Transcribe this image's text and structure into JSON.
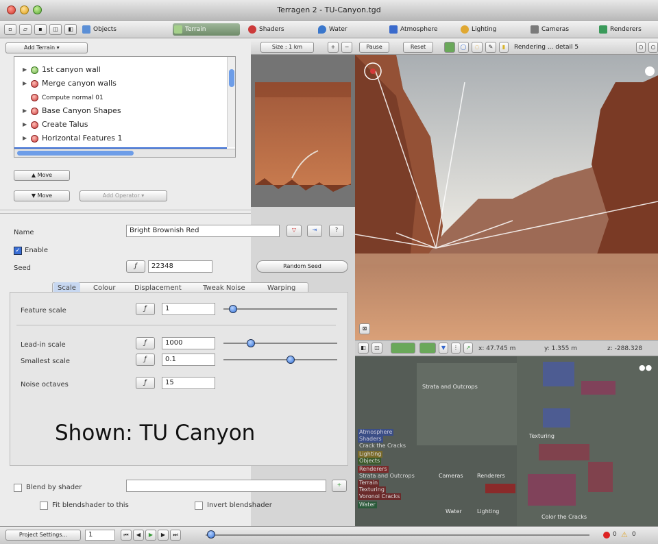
{
  "window": {
    "title": "Terragen 2 - TU-Canyon.tgd"
  },
  "tabs": [
    {
      "label": "Objects",
      "color": "#5b8fd6"
    },
    {
      "label": "Terrain",
      "color": "#6aa85a"
    },
    {
      "label": "Shaders",
      "color": "#cc3a3a"
    },
    {
      "label": "Water",
      "color": "#3a77cc"
    },
    {
      "label": "Atmosphere",
      "color": "#3a6acc"
    },
    {
      "label": "Lighting",
      "color": "#e0a832"
    },
    {
      "label": "Cameras",
      "color": "#7a7a7a"
    },
    {
      "label": "Renderers",
      "color": "#3a9a5a"
    }
  ],
  "left_toolbar": {
    "add_terrain": "Add Terrain"
  },
  "tree_items": [
    {
      "label": "1st canyon wall",
      "dot": "#6ab04a",
      "has_arrow": true
    },
    {
      "label": "Merge canyon walls",
      "dot": "#cc3a3a",
      "has_arrow": true
    },
    {
      "label": "Compute normal 01",
      "dot": "#cc3a3a",
      "has_arrow": false
    },
    {
      "label": "Base Canyon Shapes",
      "dot": "#cc3a3a",
      "has_arrow": true
    },
    {
      "label": "Create Talus",
      "dot": "#cc3a3a",
      "has_arrow": true
    },
    {
      "label": "Horizontal Features 1",
      "dot": "#cc3a3a",
      "has_arrow": true
    }
  ],
  "move_buttons": {
    "up": "▲ Move",
    "down": "▼ Move",
    "add_operator": "Add Operator"
  },
  "render_toolbar": {
    "size": "Size : 1 km",
    "pause": "Pause",
    "reset": "Reset",
    "status": "Rendering ... detail 5"
  },
  "coords": {
    "x": "x: 47.745 m",
    "y": "y: 1.355 m",
    "z": "z: -288.328"
  },
  "shader": {
    "name_label": "Name",
    "name_value": "Bright Brownish Red",
    "enable_label": "Enable",
    "seed_label": "Seed",
    "seed_value": "22348",
    "random_seed": "Random Seed"
  },
  "subtabs": [
    "Scale",
    "Colour",
    "Displacement",
    "Tweak Noise",
    "Warping"
  ],
  "params": [
    {
      "label": "Feature scale",
      "value": "1",
      "level": 0.05
    },
    {
      "label": "Lead-in scale",
      "value": "1000",
      "level": 0.22
    },
    {
      "label": "Smallest scale",
      "value": "0.1",
      "level": 0.6
    },
    {
      "label": "Noise octaves",
      "value": "15",
      "level": null
    }
  ],
  "overlay_caption": "Shown: TU Canyon",
  "blend": {
    "blend_by_shader": "Blend by shader",
    "fit_blendshader": "Fit blendshader to this",
    "invert_blendshader": "Invert blendshader"
  },
  "status": {
    "project_settings": "Project Settings...",
    "frame": "1",
    "errors": "0",
    "warnings": "0"
  },
  "node_labels": [
    "Strata and Outcrops",
    "Atmosphere",
    "Shaders",
    "Crack the Cracks",
    "Lighting",
    "Objects",
    "Renderers",
    "Strata and Outcrops",
    "Terrain",
    "Texturing",
    "Voronoi Cracks",
    "Water",
    "Cameras",
    "Renderers",
    "Water",
    "Lighting",
    "Texturing",
    "Color the Cracks"
  ]
}
